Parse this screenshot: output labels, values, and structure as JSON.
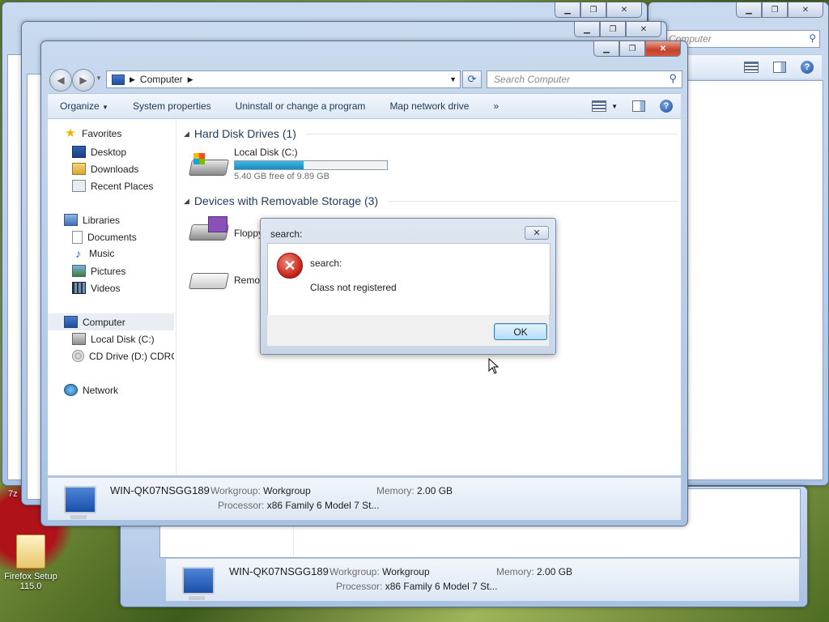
{
  "desktop": {
    "icon_label_line1": "Firefox Setup",
    "icon_label_line2": "115.0",
    "partial_label": "7z"
  },
  "back_window_search_placeholder": "Computer",
  "main_window": {
    "address": {
      "location": "Computer"
    },
    "search": {
      "placeholder": "Search Computer"
    },
    "toolbar": {
      "organize": "Organize",
      "system_properties": "System properties",
      "uninstall": "Uninstall or change a program",
      "map_drive": "Map network drive",
      "more": "»"
    },
    "nav": {
      "favorites": "Favorites",
      "desktop": "Desktop",
      "downloads": "Downloads",
      "recent_places": "Recent Places",
      "libraries": "Libraries",
      "documents": "Documents",
      "music": "Music",
      "pictures": "Pictures",
      "videos": "Videos",
      "computer": "Computer",
      "local_disk": "Local Disk (C:)",
      "cd_drive": "CD Drive (D:) CDROM",
      "network": "Network"
    },
    "groups": {
      "hdd": "Hard Disk Drives (1)",
      "removable": "Devices with Removable Storage (3)"
    },
    "drives": {
      "local_name": "Local Disk (C:)",
      "local_free": "5.40 GB free of 9.89 GB",
      "local_used_fraction": 0.45,
      "floppy_name": "Floppy",
      "removable_name": "Remov"
    },
    "details": {
      "computer_name": "WIN-QK07NSGG189",
      "workgroup_label": "Workgroup:",
      "workgroup": "Workgroup",
      "memory_label": "Memory:",
      "memory": "2.00 GB",
      "processor_label": "Processor:",
      "processor": "x86 Family 6 Model 7 St..."
    }
  },
  "lower_window_details": {
    "computer_name": "WIN-QK07NSGG189",
    "workgroup_label": "Workgroup:",
    "workgroup": "Workgroup",
    "memory_label": "Memory:",
    "memory": "2.00 GB",
    "processor_label": "Processor:",
    "processor": "x86 Family 6 Model 7 St..."
  },
  "dialog": {
    "title": "search:",
    "message_title": "search:",
    "message": "Class not registered",
    "ok": "OK"
  },
  "colors": {
    "titlebar": "#b9cde8",
    "close_red": "#c4402a",
    "progress": "#1a8bbf",
    "error_red": "#c41d12"
  }
}
